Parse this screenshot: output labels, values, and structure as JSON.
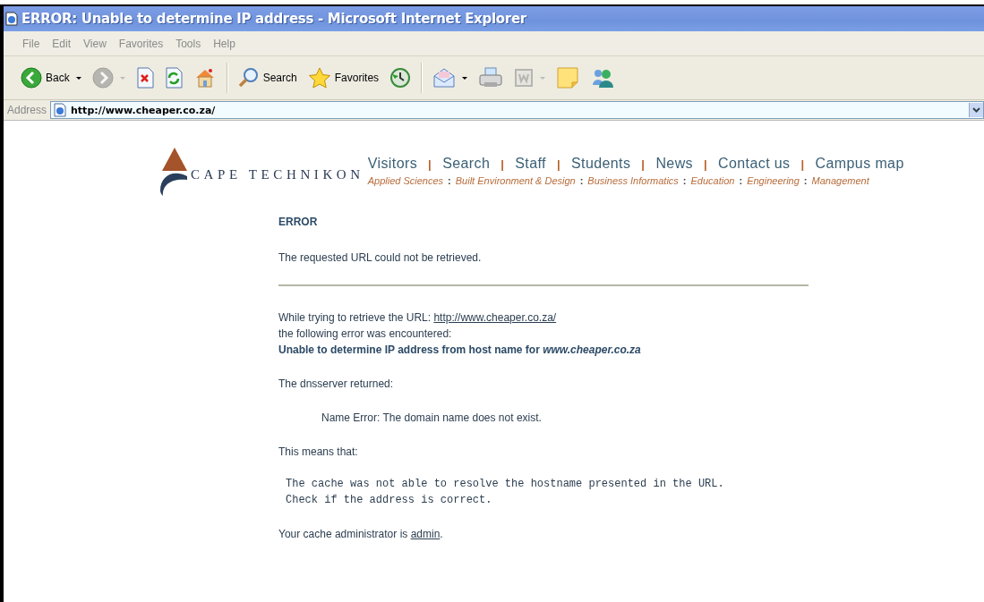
{
  "window": {
    "title": "ERROR: Unable to determine IP address - Microsoft Internet Explorer"
  },
  "menu": [
    "File",
    "Edit",
    "View",
    "Favorites",
    "Tools",
    "Help"
  ],
  "toolbar": [
    {
      "kind": "back",
      "label": "Back",
      "dropdown": true,
      "disabled": false
    },
    {
      "kind": "forward",
      "dropdown": true,
      "disabled": true
    },
    {
      "kind": "stop",
      "dropdown": false,
      "disabled": false
    },
    {
      "kind": "refresh",
      "dropdown": false,
      "disabled": false
    },
    {
      "kind": "home",
      "dropdown": false,
      "disabled": false
    },
    {
      "kind": "separator"
    },
    {
      "kind": "search",
      "label": "Search",
      "dropdown": false,
      "disabled": false
    },
    {
      "kind": "favorites",
      "label": "Favorites",
      "dropdown": false,
      "disabled": false
    },
    {
      "kind": "history",
      "dropdown": false,
      "disabled": false
    },
    {
      "kind": "separator"
    },
    {
      "kind": "mail",
      "dropdown": true,
      "disabled": false
    },
    {
      "kind": "print",
      "dropdown": false,
      "disabled": false
    },
    {
      "kind": "edit",
      "dropdown": true,
      "disabled": true
    },
    {
      "kind": "note",
      "dropdown": false,
      "disabled": false
    },
    {
      "kind": "messenger",
      "dropdown": false,
      "disabled": false
    }
  ],
  "address": {
    "label": "Address",
    "value": "http://www.cheaper.co.za/"
  },
  "site": {
    "logo": "CAPE TECHNIKON",
    "nav": [
      {
        "kind": "link",
        "text": "Visitors"
      },
      {
        "kind": "separator",
        "text": "|"
      },
      {
        "kind": "link",
        "text": "Search"
      },
      {
        "kind": "separator",
        "text": "|"
      },
      {
        "kind": "link",
        "text": "Staff"
      },
      {
        "kind": "separator",
        "text": "|"
      },
      {
        "kind": "link",
        "text": "Students"
      },
      {
        "kind": "separator",
        "text": "|"
      },
      {
        "kind": "link",
        "text": "News"
      },
      {
        "kind": "separator",
        "text": "|"
      },
      {
        "kind": "link",
        "text": "Contact us"
      },
      {
        "kind": "separator",
        "text": "|"
      },
      {
        "kind": "link",
        "text": "Campus map"
      }
    ],
    "faculties": [
      {
        "kind": "link",
        "text": "Applied Sciences"
      },
      {
        "kind": "separator",
        "text": ":"
      },
      {
        "kind": "link",
        "text": "Built Environment & Design"
      },
      {
        "kind": "separator",
        "text": ":"
      },
      {
        "kind": "link",
        "text": "Business Informatics"
      },
      {
        "kind": "separator",
        "text": ":"
      },
      {
        "kind": "link",
        "text": "Education"
      },
      {
        "kind": "separator",
        "text": ":"
      },
      {
        "kind": "link",
        "text": "Engineering"
      },
      {
        "kind": "separator",
        "text": ":"
      },
      {
        "kind": "link",
        "text": "Management"
      }
    ]
  },
  "error": {
    "heading": "ERROR",
    "summary": "The requested URL could not be retrieved.",
    "retrieve_text": "While trying to retrieve the URL:",
    "retrieve_link": "http://www.cheaper.co.za/",
    "encountered": "the following error was encountered:",
    "message": "**Unable to determine IP address from host name for** *www.cheaper.co.za*",
    "dns_label": "The dnsserver returned:",
    "dns_message": "Name Error: The domain name does not exist.",
    "means_label": "This means that:",
    "explanation": [
      "The cache was not able to resolve the hostname presented in the URL.",
      "Check if the address is correct."
    ],
    "admin_text": "Your cache administrator is",
    "admin_link": "admin",
    "admin_end": "."
  }
}
